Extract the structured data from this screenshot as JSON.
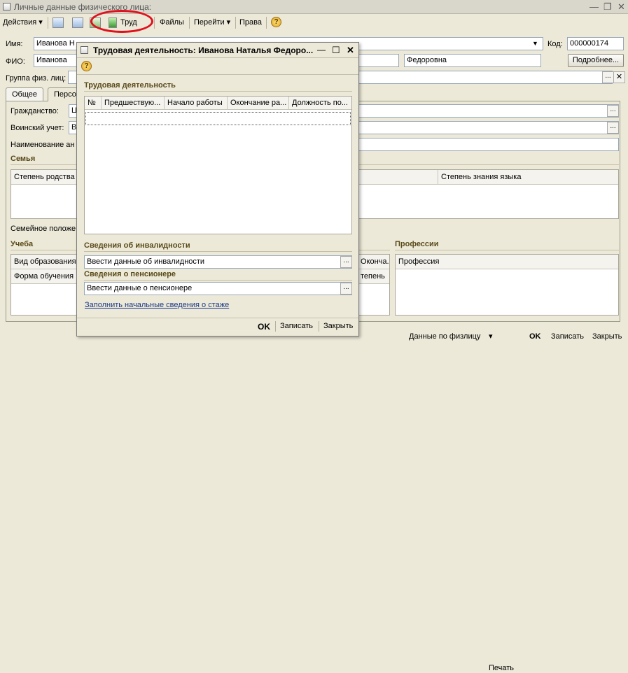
{
  "main_window": {
    "title": "Личные данные физического лица:",
    "controls": {
      "minimize": "—",
      "restore": "❐",
      "close": "✕"
    }
  },
  "toolbar": {
    "actions_label": "Действия",
    "trud_label": "Труд",
    "files_label": "Файлы",
    "goto_label": "Перейти",
    "rights_label": "Права",
    "help": "?"
  },
  "form": {
    "name_label": "Имя:",
    "name_value": "Иванова Н",
    "code_label": "Код:",
    "code_value": "000000174",
    "fio_label": "ФИО:",
    "surname_value": "Иванова",
    "patronymic_value": "Федоровна",
    "more_button": "Подробнее...",
    "group_label": "Группа физ. лиц:",
    "tabs": [
      "Общее",
      "Персо"
    ],
    "citizenship_label": "Гражданство:",
    "citizenship_value": "Ц",
    "military_label": "Воинский учет:",
    "military_value": "В",
    "name_an_label": "Наименование ан",
    "family_title": "Семья",
    "family_col1": "Степень родства",
    "family_col2": "Степень знания языка",
    "marital_label": "Семейное положе",
    "study_title": "Учеба",
    "study_col1": "Вид образования",
    "study_col2": "Форма обучения",
    "study_col3": "Оконча...",
    "study_col4": "тепень",
    "professions_title": "Профессии",
    "profession_col": "Профессия"
  },
  "bottom_bar": {
    "person_data": "Данные по физлицу",
    "print": "Печать",
    "ok": "OK",
    "save": "Записать",
    "close": "Закрыть"
  },
  "dialog": {
    "title": "Трудовая деятельность: Иванова Наталья Федоро...",
    "controls": {
      "minimize": "—",
      "maximize": "☐",
      "close": "✕"
    },
    "help": "?",
    "section_title": "Трудовая деятельность",
    "columns": [
      "№",
      "Предшествую...",
      "Начало работы",
      "Окончание ра...",
      "Должность по..."
    ],
    "disability_title": "Сведения об инвалидности",
    "disability_value": "Ввести данные об инвалидности",
    "pensioner_title": "Сведения о пенсионере",
    "pensioner_value": "Ввести данные о пенсионере",
    "fill_link": "Заполнить начальные сведения о стаже",
    "ok": "OK",
    "save": "Записать",
    "close": "Закрыть"
  },
  "colors": {
    "highlight": "#e0101c",
    "section_title": "#5a4a1a"
  }
}
